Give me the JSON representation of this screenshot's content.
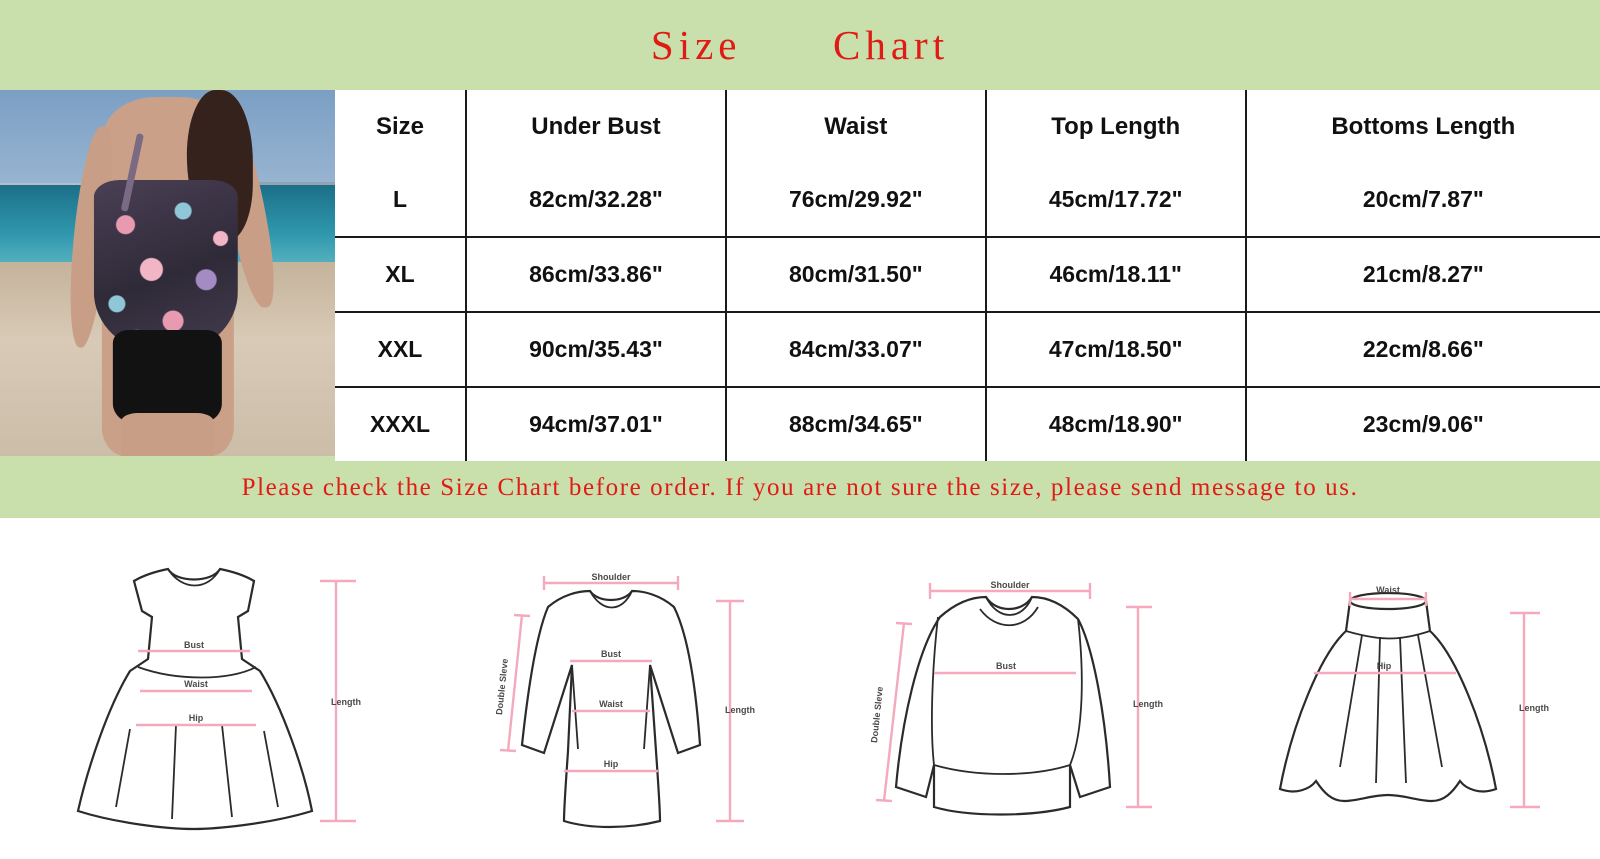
{
  "banner": {
    "title": "Size      Chart",
    "background_color": "#c9e0ad",
    "text_color": "#e01b16"
  },
  "product_photo": {
    "alt": "model-wearing-floral-tankini-and-black-swim-shorts-on-beach"
  },
  "table": {
    "headers": [
      "Size",
      "Under Bust",
      "Waist",
      "Top Length",
      "Bottoms Length"
    ],
    "rows": [
      {
        "size": "L",
        "under_bust": "82cm/32.28\"",
        "waist": "76cm/29.92\"",
        "top_length": "45cm/17.72\"",
        "bottoms_length": "20cm/7.87\""
      },
      {
        "size": "XL",
        "under_bust": "86cm/33.86\"",
        "waist": "80cm/31.50\"",
        "top_length": "46cm/18.11\"",
        "bottoms_length": "21cm/8.27\""
      },
      {
        "size": "XXL",
        "under_bust": "90cm/35.43\"",
        "waist": "84cm/33.07\"",
        "top_length": "47cm/18.50\"",
        "bottoms_length": "22cm/8.66\""
      },
      {
        "size": "XXXL",
        "under_bust": "94cm/37.01\"",
        "waist": "88cm/34.65\"",
        "top_length": "48cm/18.90\"",
        "bottoms_length": "23cm/9.06\""
      }
    ]
  },
  "notice": {
    "text": "Please check the Size Chart before order. If you are not sure the size, please send message to us.",
    "background_color": "#c9e0ad",
    "text_color": "#e01b16"
  },
  "diagrams": [
    {
      "name": "sleeveless-dress",
      "labels": {
        "bust": "Bust",
        "waist": "Waist",
        "hip": "Hip",
        "length": "Length"
      }
    },
    {
      "name": "long-sleeve-top",
      "labels": {
        "shoulder": "Shoulder",
        "sleeve": "Double Sleve",
        "bust": "Bust",
        "waist": "Waist",
        "hip": "Hip",
        "length": "Length"
      }
    },
    {
      "name": "sweatshirt",
      "labels": {
        "shoulder": "Shoulder",
        "sleeve": "Double Sleve",
        "bust": "Bust",
        "length": "Length"
      }
    },
    {
      "name": "skirt",
      "labels": {
        "waist": "Waist",
        "hip": "Hip",
        "length": "Length"
      }
    }
  ]
}
